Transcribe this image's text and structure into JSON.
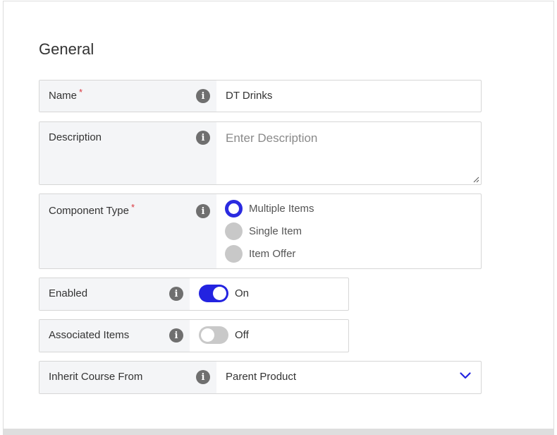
{
  "section": {
    "title": "General"
  },
  "fields": {
    "name": {
      "label": "Name",
      "required": "*",
      "value": "DT Drinks"
    },
    "description": {
      "label": "Description",
      "placeholder": "Enter Description"
    },
    "component_type": {
      "label": "Component Type",
      "required": "*",
      "options": [
        "Multiple Items",
        "Single Item",
        "Item Offer"
      ],
      "selected": "Multiple Items"
    },
    "enabled": {
      "label": "Enabled",
      "state": "On"
    },
    "associated_items": {
      "label": "Associated Items",
      "state": "Off"
    },
    "inherit_course": {
      "label": "Inherit Course From",
      "value": "Parent Product"
    }
  },
  "icons": {
    "info": "info-icon",
    "dropdown": "chevron-down-icon"
  },
  "colors": {
    "accent": "#2323e0",
    "required": "#d9363e",
    "label_bg": "#f4f5f7"
  }
}
